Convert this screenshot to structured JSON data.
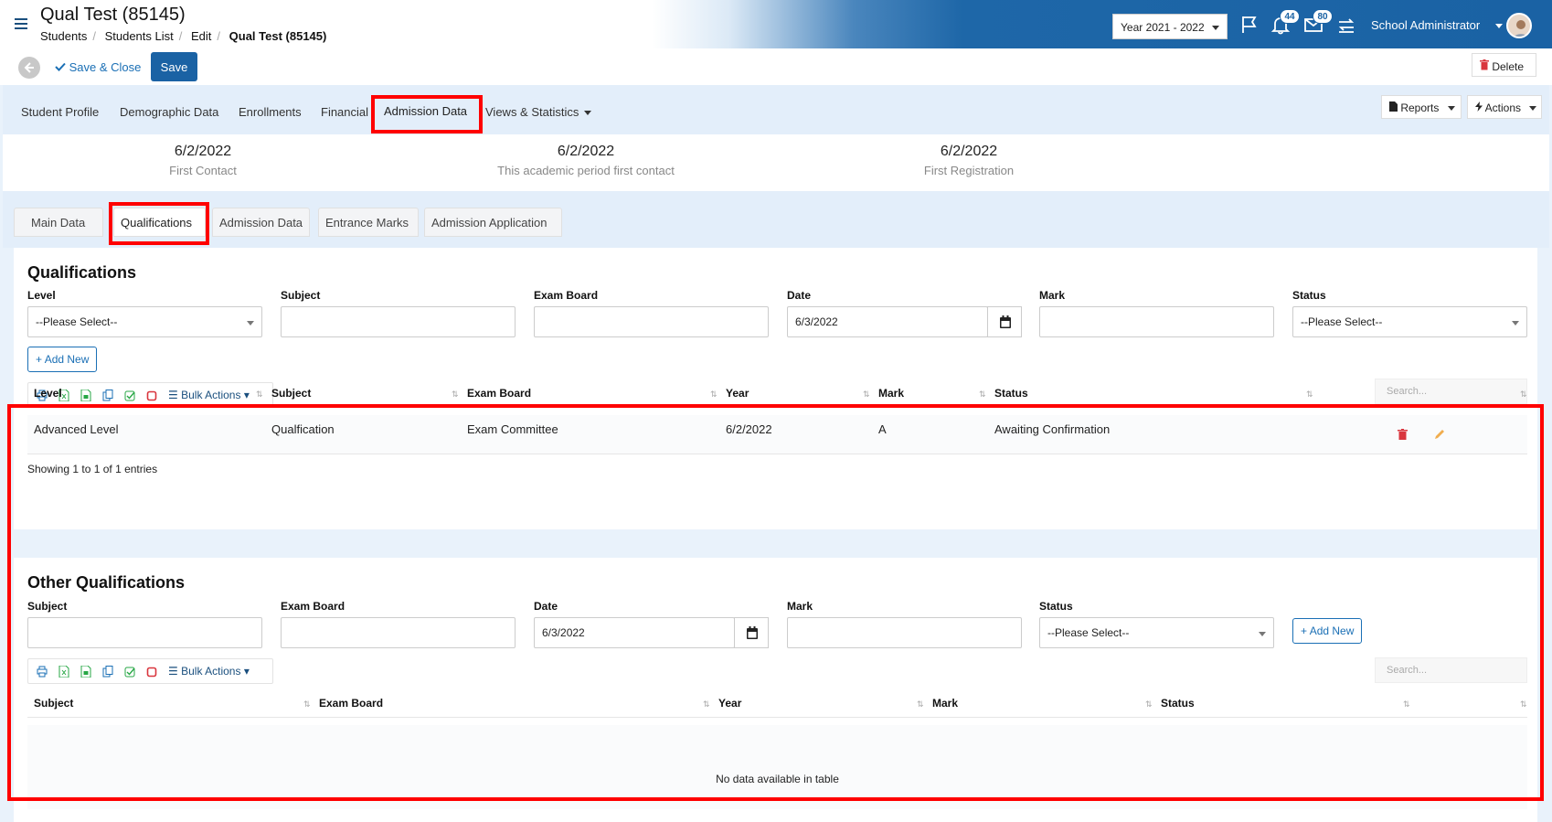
{
  "header": {
    "title": "Qual Test (85145)",
    "breadcrumb": [
      "Students",
      "Students List",
      "Edit",
      "Qual Test (85145)"
    ],
    "year": "Year 2021 - 2022",
    "notifications_count": "44",
    "messages_count": "80",
    "user": "School Administrator"
  },
  "toolbar": {
    "save_close": "Save & Close",
    "save": "Save",
    "delete": "Delete"
  },
  "nav": {
    "tabs": [
      "Student Profile",
      "Demographic Data",
      "Enrollments",
      "Financial",
      "Admission Data",
      "Views & Statistics"
    ],
    "active": "Admission Data",
    "reports": "Reports",
    "actions": "Actions"
  },
  "info": [
    {
      "value": "6/2/2022",
      "label": "First Contact"
    },
    {
      "value": "6/2/2022",
      "label": "This academic period first contact"
    },
    {
      "value": "6/2/2022",
      "label": "First Registration"
    }
  ],
  "subtabs": [
    "Main Data",
    "Qualifications",
    "Admission Data",
    "Entrance Marks",
    "Admission Application"
  ],
  "qualifications": {
    "title": "Qualifications",
    "labels": {
      "level": "Level",
      "subject": "Subject",
      "exam_board": "Exam Board",
      "date": "Date",
      "mark": "Mark",
      "status": "Status"
    },
    "level_value": "--Please Select--",
    "date_value": "6/3/2022",
    "status_value": "--Please Select--",
    "add_new": "Add New",
    "bulk_actions": "Bulk Actions",
    "search_placeholder": "Search...",
    "columns": [
      "Level",
      "Subject",
      "Exam Board",
      "Year",
      "Mark",
      "Status"
    ],
    "rows": [
      {
        "level": "Advanced Level",
        "subject": "Qualfication",
        "exam_board": "Exam Committee",
        "year": "6/2/2022",
        "mark": "A",
        "status": "Awaiting Confirmation"
      }
    ],
    "info": "Showing 1 to 1 of 1 entries"
  },
  "other_qualifications": {
    "title": "Other Qualifications",
    "labels": {
      "subject": "Subject",
      "exam_board": "Exam Board",
      "date": "Date",
      "mark": "Mark",
      "status": "Status"
    },
    "date_value": "6/3/2022",
    "status_value": "--Please Select--",
    "add_new": "Add New",
    "bulk_actions": "Bulk Actions",
    "search_placeholder": "Search...",
    "columns": [
      "Subject",
      "Exam Board",
      "Year",
      "Mark",
      "Status"
    ],
    "empty": "No data available in table"
  },
  "colors": {
    "primary": "#1a62a4",
    "highlight": "#ff0000",
    "delete_icon": "#d9363e",
    "edit_icon": "#f0ad4e"
  }
}
